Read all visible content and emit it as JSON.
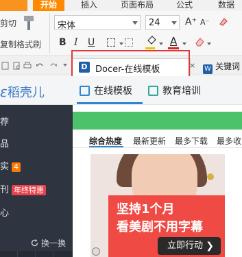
{
  "menubar": {
    "tabs": [
      {
        "label": "开始",
        "active": true
      },
      {
        "label": "插入",
        "active": false
      },
      {
        "label": "页面布局",
        "active": false
      },
      {
        "label": "公式",
        "active": false
      },
      {
        "label": "数据",
        "active": false
      }
    ]
  },
  "ribbon": {
    "cut_label": "剪切",
    "copy_label": "复制",
    "format_painter_label": "格式刷",
    "font_name": "宋体",
    "font_size": "24",
    "bold": "B",
    "italic": "I",
    "underline": "U",
    "font_color_glyph": "A",
    "grow_glyph": "A⁺",
    "shrink_glyph": "A⁻"
  },
  "tabstrip": {
    "doc_tab": {
      "icon_letter": "D",
      "label": "Docer-在线模板"
    },
    "close_glyph": "×",
    "keyword_tab": {
      "icon_letter": "W",
      "label": "关键词"
    }
  },
  "docer": {
    "brand": "稻壳儿",
    "brand_glyph": "ε",
    "nav": [
      {
        "label": "在线模板",
        "active": true
      },
      {
        "label": "教育培训",
        "active": false
      }
    ]
  },
  "sidebar": {
    "items": [
      {
        "label": "荐"
      },
      {
        "label": "品"
      },
      {
        "label": "实",
        "badge": "4"
      },
      {
        "label": "刊",
        "promo": "年终特惠"
      },
      {
        "label": "心"
      }
    ],
    "refresh_label": "换一换"
  },
  "content": {
    "sort_tabs": [
      {
        "label": "综合热度",
        "active": true
      },
      {
        "label": "最新更新",
        "active": false
      },
      {
        "label": "最多下载",
        "active": false
      },
      {
        "label": "最多收",
        "active": false
      }
    ],
    "banner": {
      "line1": "坚持1个月",
      "line2": "看美剧不用字幕",
      "cta": "立即行动",
      "cta_chevron": "❯"
    }
  },
  "colors": {
    "accent_orange": "#ff8a00",
    "docer_blue": "#2b87d1",
    "green_bar": "#4cc36b",
    "banner_red": "#f04a45",
    "highlight_red": "#e03a3a",
    "sidebar_dark": "#2e3440"
  }
}
